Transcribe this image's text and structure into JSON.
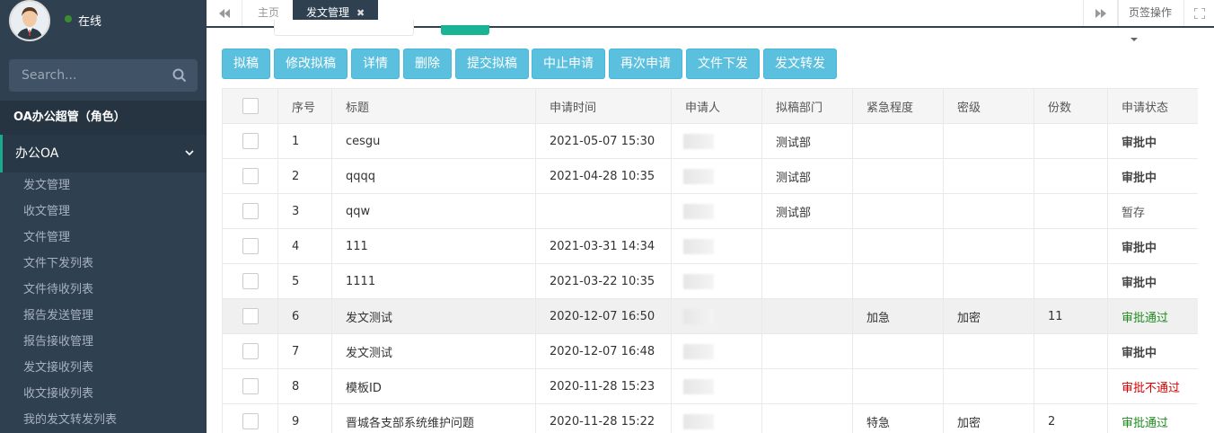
{
  "sidebar": {
    "status": "在线",
    "search_placeholder": "Search...",
    "role": "OA办公超管（角色）",
    "group": "办公OA",
    "items": [
      "发文管理",
      "收文管理",
      "文件管理",
      "文件下发列表",
      "文件待收列表",
      "报告发送管理",
      "报告接收管理",
      "发文接收列表",
      "收文接收列表",
      "我的发文转发列表"
    ]
  },
  "tabs": {
    "home": "主页",
    "active": "发文管理",
    "page_ops": "页签操作"
  },
  "toolbar": {
    "draft": "拟稿",
    "edit_draft": "修改拟稿",
    "detail": "详情",
    "delete": "删除",
    "submit_draft": "提交拟稿",
    "abort": "中止申请",
    "reapply": "再次申请",
    "distribute": "文件下发",
    "forward": "发文转发"
  },
  "table": {
    "headers": [
      "序号",
      "标题",
      "申请时间",
      "申请人",
      "拟稿部门",
      "紧急程度",
      "密级",
      "份数",
      "申请状态"
    ],
    "rows": [
      {
        "no": "1",
        "title": "cesgu",
        "time": "2021-05-07 15:30",
        "dept": "测试部",
        "urgency": "",
        "secret": "",
        "copies": "",
        "status": "审批中"
      },
      {
        "no": "2",
        "title": "qqqq",
        "time": "2021-04-28 10:35",
        "dept": "测试部",
        "urgency": "",
        "secret": "",
        "copies": "",
        "status": "审批中"
      },
      {
        "no": "3",
        "title": "qqw",
        "time": "",
        "dept": "测试部",
        "urgency": "",
        "secret": "",
        "copies": "",
        "status": "暂存"
      },
      {
        "no": "4",
        "title": "111",
        "time": "2021-03-31 14:34",
        "dept": "",
        "urgency": "",
        "secret": "",
        "copies": "",
        "status": "审批中"
      },
      {
        "no": "5",
        "title": "1111",
        "time": "2021-03-22 10:35",
        "dept": "",
        "urgency": "",
        "secret": "",
        "copies": "",
        "status": "审批中"
      },
      {
        "no": "6",
        "title": "发文测试",
        "time": "2020-12-07 16:50",
        "dept": "",
        "urgency": "加急",
        "secret": "加密",
        "copies": "11",
        "status": "审批通过"
      },
      {
        "no": "7",
        "title": "发文测试",
        "time": "2020-12-07 16:48",
        "dept": "",
        "urgency": "",
        "secret": "",
        "copies": "",
        "status": "审批中"
      },
      {
        "no": "8",
        "title": "模板ID",
        "time": "2020-11-28 15:23",
        "dept": "",
        "urgency": "",
        "secret": "",
        "copies": "",
        "status": "审批不通过"
      },
      {
        "no": "9",
        "title": "晋城各支部系统维护问题",
        "time": "2020-11-28 15:22",
        "dept": "",
        "urgency": "特急",
        "secret": "加密",
        "copies": "2",
        "status": "审批通过"
      }
    ]
  },
  "colors": {
    "sidebar": "#2f4050",
    "accent": "#5bc0de",
    "approved": "#1e8c1e",
    "rejected": "#d90000"
  }
}
